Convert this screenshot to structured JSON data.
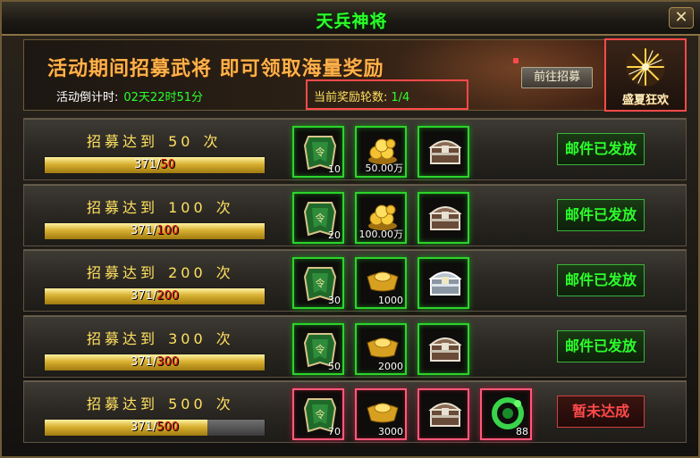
{
  "window": {
    "title": "天兵神将",
    "close_label": "✕"
  },
  "banner": {
    "headline": "活动期间招募武将 即可领取海量奖励",
    "countdown_label": "活动倒计时:",
    "countdown_value": "02天22时51分",
    "round_label": "当前奖励轮数:",
    "round_value": "1/4",
    "goto_button": "前往招募"
  },
  "festival": {
    "label": "盛夏狂欢",
    "icon": "fireworks-icon"
  },
  "rows": [
    {
      "prefix": "招募达到",
      "target": "50",
      "suffix": "次",
      "current": "371",
      "target_text": "50",
      "progress": 1.0,
      "rewards": [
        {
          "icon": "token-icon",
          "qty": "10"
        },
        {
          "icon": "gold-coins-icon",
          "qty": "50.00万"
        },
        {
          "icon": "chest-icon",
          "qty": ""
        }
      ],
      "status": "邮件已发放",
      "claimed": true
    },
    {
      "prefix": "招募达到",
      "target": "100",
      "suffix": "次",
      "current": "371",
      "target_text": "100",
      "progress": 1.0,
      "rewards": [
        {
          "icon": "token-icon",
          "qty": "20"
        },
        {
          "icon": "gold-coins-icon",
          "qty": "100.00万"
        },
        {
          "icon": "chest-icon",
          "qty": ""
        }
      ],
      "status": "邮件已发放",
      "claimed": true
    },
    {
      "prefix": "招募达到",
      "target": "200",
      "suffix": "次",
      "current": "371",
      "target_text": "200",
      "progress": 1.0,
      "rewards": [
        {
          "icon": "token-icon",
          "qty": "30"
        },
        {
          "icon": "gold-ingot-icon",
          "qty": "1000"
        },
        {
          "icon": "silver-chest-icon",
          "qty": ""
        }
      ],
      "status": "邮件已发放",
      "claimed": true
    },
    {
      "prefix": "招募达到",
      "target": "300",
      "suffix": "次",
      "current": "371",
      "target_text": "300",
      "progress": 1.0,
      "rewards": [
        {
          "icon": "token-icon",
          "qty": "50"
        },
        {
          "icon": "gold-ingot-icon",
          "qty": "2000"
        },
        {
          "icon": "chest-icon",
          "qty": ""
        }
      ],
      "status": "邮件已发放",
      "claimed": true
    },
    {
      "prefix": "招募达到",
      "target": "500",
      "suffix": "次",
      "current": "371",
      "target_text": "500",
      "progress": 0.742,
      "rewards": [
        {
          "icon": "token-icon",
          "qty": "70"
        },
        {
          "icon": "gold-ingot-icon",
          "qty": "3000"
        },
        {
          "icon": "chest-icon",
          "qty": ""
        },
        {
          "icon": "jade-dragon-icon",
          "qty": "88"
        }
      ],
      "status": "暂未达成",
      "claimed": false
    }
  ],
  "colors": {
    "accent_green": "#2cff2c",
    "headline_orange": "#ffb24a",
    "highlight_red": "#ff4a4a",
    "gold_text": "#ffe060"
  }
}
